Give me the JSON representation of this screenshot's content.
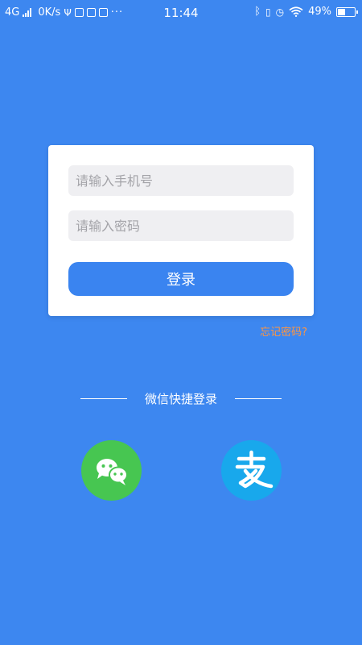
{
  "status_bar": {
    "network": "4G",
    "speed": "0K/s",
    "time": "11:44",
    "battery": "49%",
    "battery_level": 0.49
  },
  "login_form": {
    "phone_placeholder": "请输入手机号",
    "password_placeholder": "请输入密码",
    "login_button_label": "登录"
  },
  "forgot_password_label": "忘记密码?",
  "quick_login": {
    "label": "微信快捷登录",
    "options": [
      {
        "icon": "wechat-icon",
        "color": "#47c651"
      },
      {
        "icon": "alipay-icon",
        "color": "#18a8ec"
      }
    ]
  },
  "colors": {
    "background": "#3d87f0",
    "button": "#3a84f0",
    "forgot_link": "#ff9540"
  }
}
